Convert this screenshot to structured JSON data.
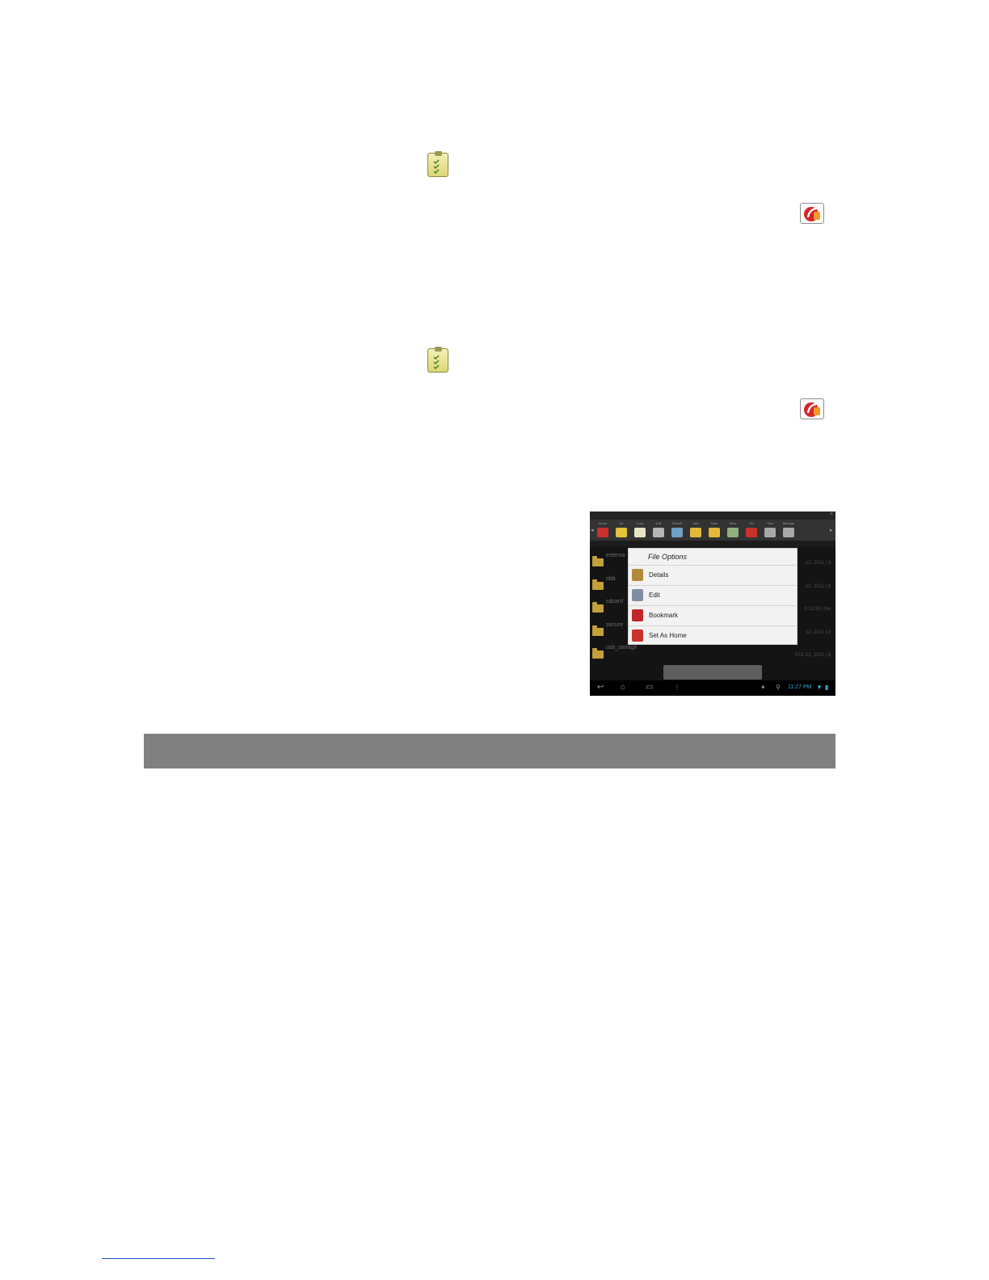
{
  "screenshot": {
    "toolbar_buttons": [
      {
        "label": "Home",
        "color": "#c8312c"
      },
      {
        "label": "Up",
        "color": "#e3c13a"
      },
      {
        "label": "Copy",
        "color": "#e6e6c4"
      },
      {
        "label": "Edit",
        "color": "#b5b5b5"
      },
      {
        "label": "Search",
        "color": "#6fa0c8"
      },
      {
        "label": "Add",
        "color": "#e3b83a"
      },
      {
        "label": "New",
        "color": "#e3b83a"
      },
      {
        "label": "View",
        "color": "#8fb07a"
      },
      {
        "label": "Sel",
        "color": "#c8312c"
      },
      {
        "label": "Tool",
        "color": "#a8a8a8"
      },
      {
        "label": "Manage",
        "color": "#a8a8a8"
      }
    ],
    "files": [
      {
        "name": "externa",
        "date": "12, 2011 | d"
      },
      {
        "name": "obb",
        "date": "12, 2011 | d"
      },
      {
        "name": "sdcard",
        "date": "9 21:28 | lrw"
      },
      {
        "name": "secure",
        "date": "12, 2011 | d"
      },
      {
        "name": "usb_storage",
        "date": "0:01:12, 2011 | d"
      }
    ],
    "dialog": {
      "title": "File Options",
      "items": [
        {
          "label": "Details",
          "icon": "details-icon",
          "color": "#b08a3a"
        },
        {
          "label": "Edit",
          "icon": "edit-icon",
          "color": "#7f8fa3"
        },
        {
          "label": "Bookmark",
          "icon": "bookmark-icon",
          "color": "#c0262a"
        },
        {
          "label": "Set As Home",
          "icon": "home-icon",
          "color": "#c8312c"
        }
      ]
    },
    "clock": "11:27 PM"
  }
}
